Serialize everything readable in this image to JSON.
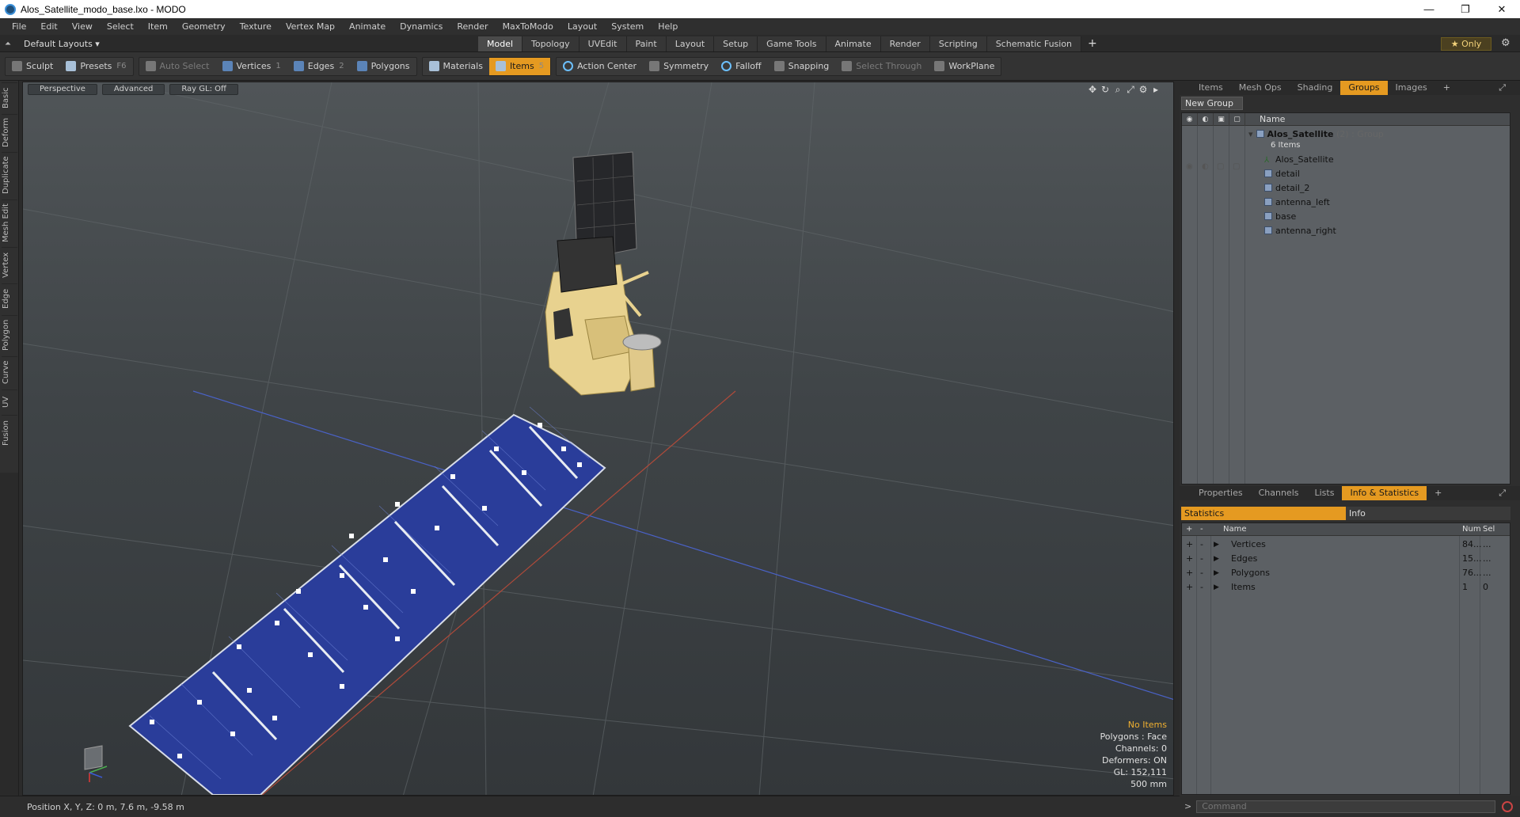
{
  "window": {
    "title": "Alos_Satellite_modo_base.lxo - MODO",
    "controls": [
      "—",
      "❐",
      "✕"
    ]
  },
  "menu": [
    "File",
    "Edit",
    "View",
    "Select",
    "Item",
    "Geometry",
    "Texture",
    "Vertex Map",
    "Animate",
    "Dynamics",
    "Render",
    "MaxToModo",
    "Layout",
    "System",
    "Help"
  ],
  "layout": {
    "selector": "Default Layouts ▾",
    "tabs": [
      "Model",
      "Topology",
      "UVEdit",
      "Paint",
      "Layout",
      "Setup",
      "Game Tools",
      "Animate",
      "Render",
      "Scripting",
      "Schematic Fusion"
    ],
    "active_tab": "Model",
    "only_label": "★  Only"
  },
  "toolbar": {
    "sculpt": "Sculpt",
    "presets": "Presets",
    "presets_key": "F6",
    "auto_select": "Auto Select",
    "vertices": "Vertices",
    "vertices_key": "1",
    "edges": "Edges",
    "edges_key": "2",
    "polygons": "Polygons",
    "materials": "Materials",
    "items": "Items",
    "items_key": "5",
    "action_center": "Action Center",
    "symmetry": "Symmetry",
    "falloff": "Falloff",
    "snapping": "Snapping",
    "select_through": "Select Through",
    "workplane": "WorkPlane"
  },
  "left_tabs": [
    "Basic",
    "Deform",
    "Duplicate",
    "Mesh Edit",
    "Vertex",
    "Edge",
    "Polygon",
    "Curve",
    "UV",
    "Fusion"
  ],
  "viewport": {
    "view": "Perspective",
    "shading": "Advanced",
    "raygl": "Ray GL: Off",
    "info": {
      "no_items": "No Items",
      "polygons": "Polygons : Face",
      "channels": "Channels: 0",
      "deformers": "Deformers: ON",
      "gl": "GL: 152,111",
      "scale": "500 mm"
    }
  },
  "status": {
    "position": "Position X, Y, Z:  0 m, 7.6 m, -9.58 m"
  },
  "groups_panel": {
    "tabs": [
      "Items",
      "Mesh Ops",
      "Shading",
      "Groups",
      "Images",
      "+"
    ],
    "active_tab": "Groups",
    "new_group": "New Group",
    "column_name": "Name",
    "group": {
      "name": "Alos_Satellite",
      "suffix": " (2) : Group",
      "count": "6 Items"
    },
    "children": [
      "Alos_Satellite",
      "detail",
      "detail_2",
      "antenna_left",
      "base",
      "antenna_right"
    ]
  },
  "stats_panel": {
    "tabs": [
      "Properties",
      "Channels",
      "Lists",
      "Info & Statistics",
      "+"
    ],
    "active_tab": "Info & Statistics",
    "subtabs": [
      "Statistics",
      "Info"
    ],
    "columns": {
      "name": "Name",
      "num": "Num",
      "sel": "Sel"
    },
    "rows": [
      {
        "name": "Vertices",
        "num": "84...",
        "sel": "..."
      },
      {
        "name": "Edges",
        "num": "15...",
        "sel": "..."
      },
      {
        "name": "Polygons",
        "num": "76...",
        "sel": "..."
      },
      {
        "name": "Items",
        "num": "1",
        "sel": "0"
      }
    ]
  },
  "command": {
    "prompt": ">",
    "placeholder": "Command"
  }
}
